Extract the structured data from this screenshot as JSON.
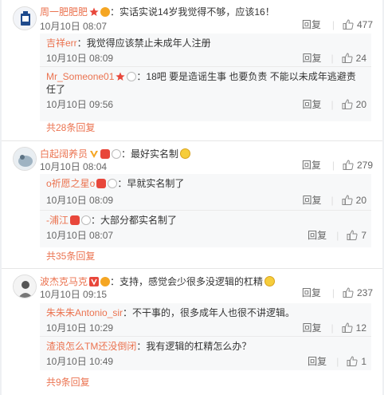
{
  "comments": [
    {
      "user": "周一肥肥肥",
      "sep": "：",
      "text": "实话实说14岁我觉得不够，应该16！",
      "time": "10月10日 08:07",
      "reply_label": "回复",
      "likes": "477",
      "replies": [
        {
          "user": "吉祥err",
          "text": "：我觉得应该禁止未成年人注册",
          "text2": "",
          "time": "10月10日 08:09",
          "reply_label": "回复",
          "likes": "24"
        },
        {
          "user": "Mr_Someone01",
          "text": "：18吧 要是造谣生事 也要负责 不能以未成年逃避责",
          "text2": "任了",
          "time": "10月10日 09:56",
          "reply_label": "回复",
          "likes": "20"
        }
      ],
      "more": "共28条回复"
    },
    {
      "user": "白起阔养员",
      "sep": "：",
      "text": "最好实名制",
      "time": "10月10日 08:04",
      "reply_label": "回复",
      "likes": "279",
      "replies": [
        {
          "user": "o祈愿之星o",
          "text": "：早就实名制了",
          "text2": "",
          "time": "10月10日 08:09",
          "reply_label": "回复",
          "likes": "20"
        },
        {
          "user": "-浦江",
          "text": "：大部分都实名制了",
          "text2": "",
          "time": "10月10日 08:07",
          "reply_label": "回复",
          "likes": "7"
        }
      ],
      "more": "共35条回复"
    },
    {
      "user": "波杰克马克",
      "sep": "：",
      "text": "支持，感觉会少很多没逻辑的杠精",
      "time": "10月10日 09:15",
      "reply_label": "回复",
      "likes": "237",
      "replies": [
        {
          "user": "朱朱朱Antonio_sir",
          "text": "：不干事的，很多成年人也很不讲逻辑。",
          "text2": "",
          "time": "10月10日 10:29",
          "reply_label": "回复",
          "likes": "12"
        },
        {
          "user": "渣浪怎么TM还没倒闭",
          "text": "：我有逻辑的杠精怎么办？",
          "text2": "",
          "time": "10月10日 10:49",
          "reply_label": "回复",
          "likes": "1"
        }
      ],
      "more": "共9条回复"
    }
  ]
}
